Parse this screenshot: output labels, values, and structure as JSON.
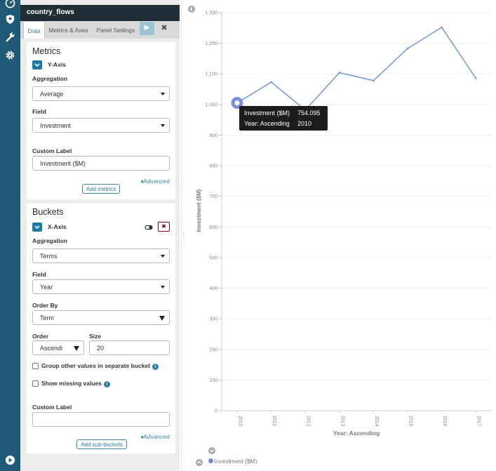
{
  "editor": {
    "title": "country_flows",
    "tabs": [
      "Data",
      "Metrics & Axes",
      "Panel Settings"
    ],
    "apply_icon": "play-icon",
    "discard_icon": "close-icon",
    "metrics": {
      "title": "Metrics",
      "agg_name": "Y-Axis",
      "aggregation_label": "Aggregation",
      "aggregation_value": "Average",
      "field_label": "Field",
      "field_value": "Investment",
      "custom_label_label": "Custom Label",
      "custom_label_value": "Investment ($M)",
      "advanced": "Advanced",
      "add_button": "Add metrics"
    },
    "buckets": {
      "title": "Buckets",
      "agg_name": "X-Axis",
      "aggregation_label": "Aggregation",
      "aggregation_value": "Terms",
      "field_label": "Field",
      "field_value": "Year",
      "order_by_label": "Order By",
      "order_by_value": "Term",
      "order_label": "Order",
      "order_value": "Ascendi",
      "size_label": "Size",
      "size_value": "20",
      "group_other_label": "Group other values in separate bucket",
      "show_missing_label": "Show missing values",
      "custom_label_label": "Custom Label",
      "custom_label_value": "",
      "advanced": "Advanced",
      "add_button": "Add sub-buckets"
    }
  },
  "tooltip": {
    "row1_label": "Investment ($M)",
    "row1_value": "754.095",
    "row2_label": "Year: Ascending",
    "row2_value": "2010"
  },
  "legend": {
    "series_name": "Investment ($M)",
    "color": "#6a8fd7"
  },
  "chart_data": {
    "type": "line",
    "x": [
      "2010",
      "2011",
      "2012",
      "2013",
      "2014",
      "2015",
      "2016",
      "2017"
    ],
    "series": [
      {
        "name": "Investment ($M)",
        "values": [
          1005,
          1073,
          982,
          1104,
          1078,
          1183,
          1252,
          1086
        ]
      }
    ],
    "ylim": [
      0,
      1300
    ],
    "yticks": [
      "0",
      "100",
      "200",
      "300",
      "400",
      "500",
      "600",
      "700",
      "800",
      "900",
      "1,000",
      "1,100",
      "1,200",
      "1,300"
    ],
    "xlabel": "Year: Ascending",
    "ylabel": "Investment ($M)",
    "grid": true,
    "highlight_index": 0,
    "line_color": "#6a8fd7",
    "highlight_color": "#7b90dc"
  }
}
